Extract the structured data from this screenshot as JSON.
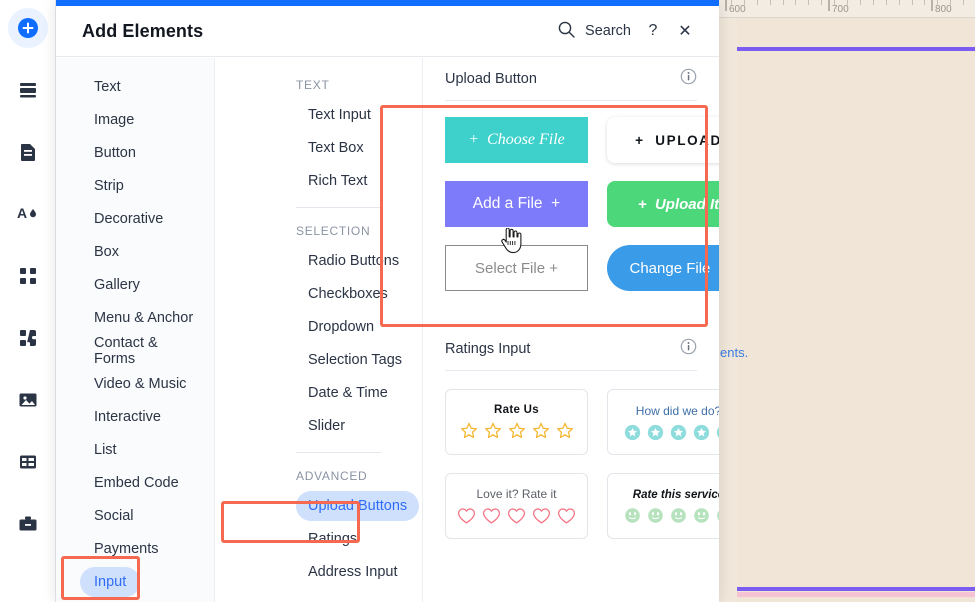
{
  "colors": {
    "accent_blue": "#116dff",
    "annotation": "#f4694f",
    "selected_pill_bg": "#cfe0fd",
    "selected_pill_text": "#2f6df6",
    "canvas_bg": "#f0e5d7",
    "guide_purple": "#7b5cf0",
    "guide_pink": "#f6c3d4"
  },
  "app_rail": {
    "items": [
      {
        "name": "add-elements-icon",
        "label": "Add Elements",
        "active": true
      },
      {
        "name": "pages-icon",
        "label": "Site Pages",
        "active": false
      },
      {
        "name": "page-icon",
        "label": "Page",
        "active": false
      },
      {
        "name": "theme-icon",
        "label": "Site Design",
        "active": false
      },
      {
        "name": "apps-icon",
        "label": "Apps",
        "active": false
      },
      {
        "name": "add-apps-icon",
        "label": "Add Apps",
        "active": false
      },
      {
        "name": "media-icon",
        "label": "Media",
        "active": false
      },
      {
        "name": "cms-icon",
        "label": "Content Manager",
        "active": false
      },
      {
        "name": "business-icon",
        "label": "Business Tools",
        "active": false
      }
    ]
  },
  "header": {
    "title": "Add Elements",
    "search_label": "Search",
    "help_label": "?",
    "close_label": "✕"
  },
  "categories": {
    "items": [
      {
        "label": "Text",
        "selected": false
      },
      {
        "label": "Image",
        "selected": false
      },
      {
        "label": "Button",
        "selected": false
      },
      {
        "label": "Strip",
        "selected": false
      },
      {
        "label": "Decorative",
        "selected": false
      },
      {
        "label": "Box",
        "selected": false
      },
      {
        "label": "Gallery",
        "selected": false
      },
      {
        "label": "Menu & Anchor",
        "selected": false
      },
      {
        "label": "Contact & Forms",
        "selected": false
      },
      {
        "label": "Video & Music",
        "selected": false
      },
      {
        "label": "Interactive",
        "selected": false
      },
      {
        "label": "List",
        "selected": false
      },
      {
        "label": "Embed Code",
        "selected": false
      },
      {
        "label": "Social",
        "selected": false
      },
      {
        "label": "Payments",
        "selected": false
      },
      {
        "label": "Input",
        "selected": true
      }
    ]
  },
  "types": {
    "groups": [
      {
        "label": "TEXT",
        "items": [
          {
            "label": "Text Input",
            "selected": false
          },
          {
            "label": "Text Box",
            "selected": false
          },
          {
            "label": "Rich Text",
            "selected": false
          }
        ]
      },
      {
        "label": "SELECTION",
        "items": [
          {
            "label": "Radio Buttons",
            "selected": false
          },
          {
            "label": "Checkboxes",
            "selected": false
          },
          {
            "label": "Dropdown",
            "selected": false
          },
          {
            "label": "Selection Tags",
            "selected": false
          },
          {
            "label": "Date & Time",
            "selected": false
          },
          {
            "label": "Slider",
            "selected": false
          }
        ]
      },
      {
        "label": "ADVANCED",
        "items": [
          {
            "label": "Upload Buttons",
            "selected": true
          },
          {
            "label": "Ratings",
            "selected": false
          },
          {
            "label": "Address Input",
            "selected": false
          }
        ]
      }
    ]
  },
  "preview": {
    "sections": [
      {
        "title": "Upload Button",
        "info_label": "i",
        "items": [
          {
            "name": "choose-file-button",
            "label": "Choose File",
            "plus": "before"
          },
          {
            "name": "upload-button",
            "label": "UPLOAD",
            "plus": "before"
          },
          {
            "name": "add-a-file-button",
            "label": "Add a File",
            "plus": "after"
          },
          {
            "name": "upload-it-button",
            "label": "Upload It",
            "plus": "before"
          },
          {
            "name": "select-file-button",
            "label": "Select File",
            "plus": "after"
          },
          {
            "name": "change-file-button",
            "label": "Change File",
            "plus": "after"
          }
        ]
      },
      {
        "title": "Ratings Input",
        "info_label": "i",
        "items": [
          {
            "name": "rate-us-card",
            "label": "Rate Us",
            "icon": "star-outline",
            "count": 5,
            "color": "#f5b731"
          },
          {
            "name": "how-did-we-do-card",
            "label": "How did we do?",
            "icon": "star-circle",
            "count": 5,
            "color": "#8fdcdc"
          },
          {
            "name": "love-it-rate-it-card",
            "label": "Love it? Rate it",
            "icon": "heart-outline",
            "count": 5,
            "color": "#f4707f"
          },
          {
            "name": "rate-this-service-card",
            "label": "Rate this service",
            "icon": "smiley-circle",
            "count": 5,
            "color": "#b6e2bd"
          }
        ]
      }
    ]
  },
  "canvas": {
    "ruler_labels": [
      "600",
      "700",
      "800"
    ],
    "overlay_text": "ents."
  }
}
